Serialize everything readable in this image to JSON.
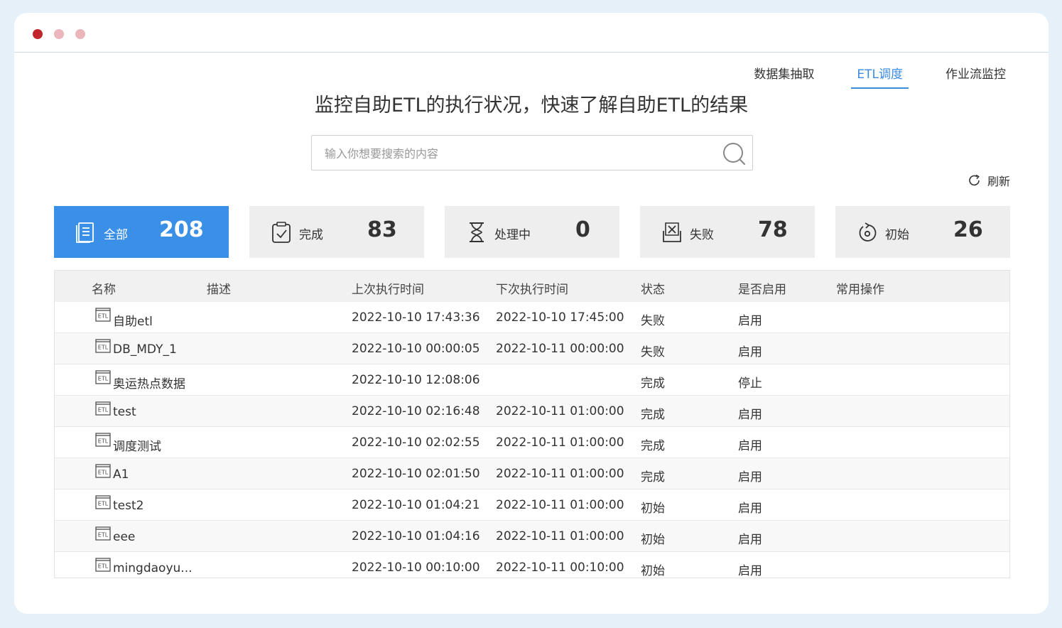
{
  "nav": {
    "tabs": [
      {
        "label": "数据集抽取"
      },
      {
        "label": "ETL调度"
      },
      {
        "label": "作业流监控"
      }
    ],
    "active_index": 1
  },
  "headline": "监控自助ETL的执行状况，快速了解自助ETL的结果",
  "search": {
    "placeholder": "输入你想要搜索的内容",
    "value": ""
  },
  "refresh_label": "刷新",
  "cards": [
    {
      "icon": "list-icon",
      "label": "全部",
      "count": "208"
    },
    {
      "icon": "clipboard-check-icon",
      "label": "完成",
      "count": "83"
    },
    {
      "icon": "hourglass-icon",
      "label": "处理中",
      "count": "0"
    },
    {
      "icon": "failed-x-icon",
      "label": "失败",
      "count": "78"
    },
    {
      "icon": "initial-reset-icon",
      "label": "初始",
      "count": "26"
    }
  ],
  "table": {
    "headers": {
      "name": "名称",
      "desc": "描述",
      "last": "上次执行时间",
      "next": "下次执行时间",
      "status": "状态",
      "enabled": "是否启用",
      "ops": "常用操作"
    },
    "rows": [
      {
        "name": "自助etl",
        "desc": "",
        "last": "2022-10-10 17:43:36",
        "next": "2022-10-10 17:45:00",
        "status": "失败",
        "enabled": "启用"
      },
      {
        "name": "DB_MDY_1",
        "desc": "",
        "last": "2022-10-10 00:00:05",
        "next": "2022-10-11 00:00:00",
        "status": "失败",
        "enabled": "启用"
      },
      {
        "name": "奥运热点数据",
        "desc": "",
        "last": "2022-10-10 12:08:06",
        "next": "",
        "status": "完成",
        "enabled": "停止"
      },
      {
        "name": "test",
        "desc": "",
        "last": "2022-10-10 02:16:48",
        "next": "2022-10-11 01:00:00",
        "status": "完成",
        "enabled": "启用"
      },
      {
        "name": "调度测试",
        "desc": "",
        "last": "2022-10-10 02:02:55",
        "next": "2022-10-11 01:00:00",
        "status": "完成",
        "enabled": "启用"
      },
      {
        "name": "A1",
        "desc": "",
        "last": "2022-10-10 02:01:50",
        "next": "2022-10-11 01:00:00",
        "status": "完成",
        "enabled": "启用"
      },
      {
        "name": "test2",
        "desc": "",
        "last": "2022-10-10 01:04:21",
        "next": "2022-10-11 01:00:00",
        "status": "初始",
        "enabled": "启用"
      },
      {
        "name": "eee",
        "desc": "",
        "last": "2022-10-10 01:04:16",
        "next": "2022-10-11 01:00:00",
        "status": "初始",
        "enabled": "启用"
      },
      {
        "name": "mingdaoyu...",
        "desc": "",
        "last": "2022-10-10 00:10:00",
        "next": "2022-10-11 00:10:00",
        "status": "初始",
        "enabled": "启用"
      }
    ],
    "row_icon": "etl-file-icon",
    "row_icon_text": "ETL"
  },
  "colors": {
    "accent": "#3a8fe6",
    "card_bg": "#eeeeee",
    "window_bg": "#e6f0f8"
  }
}
